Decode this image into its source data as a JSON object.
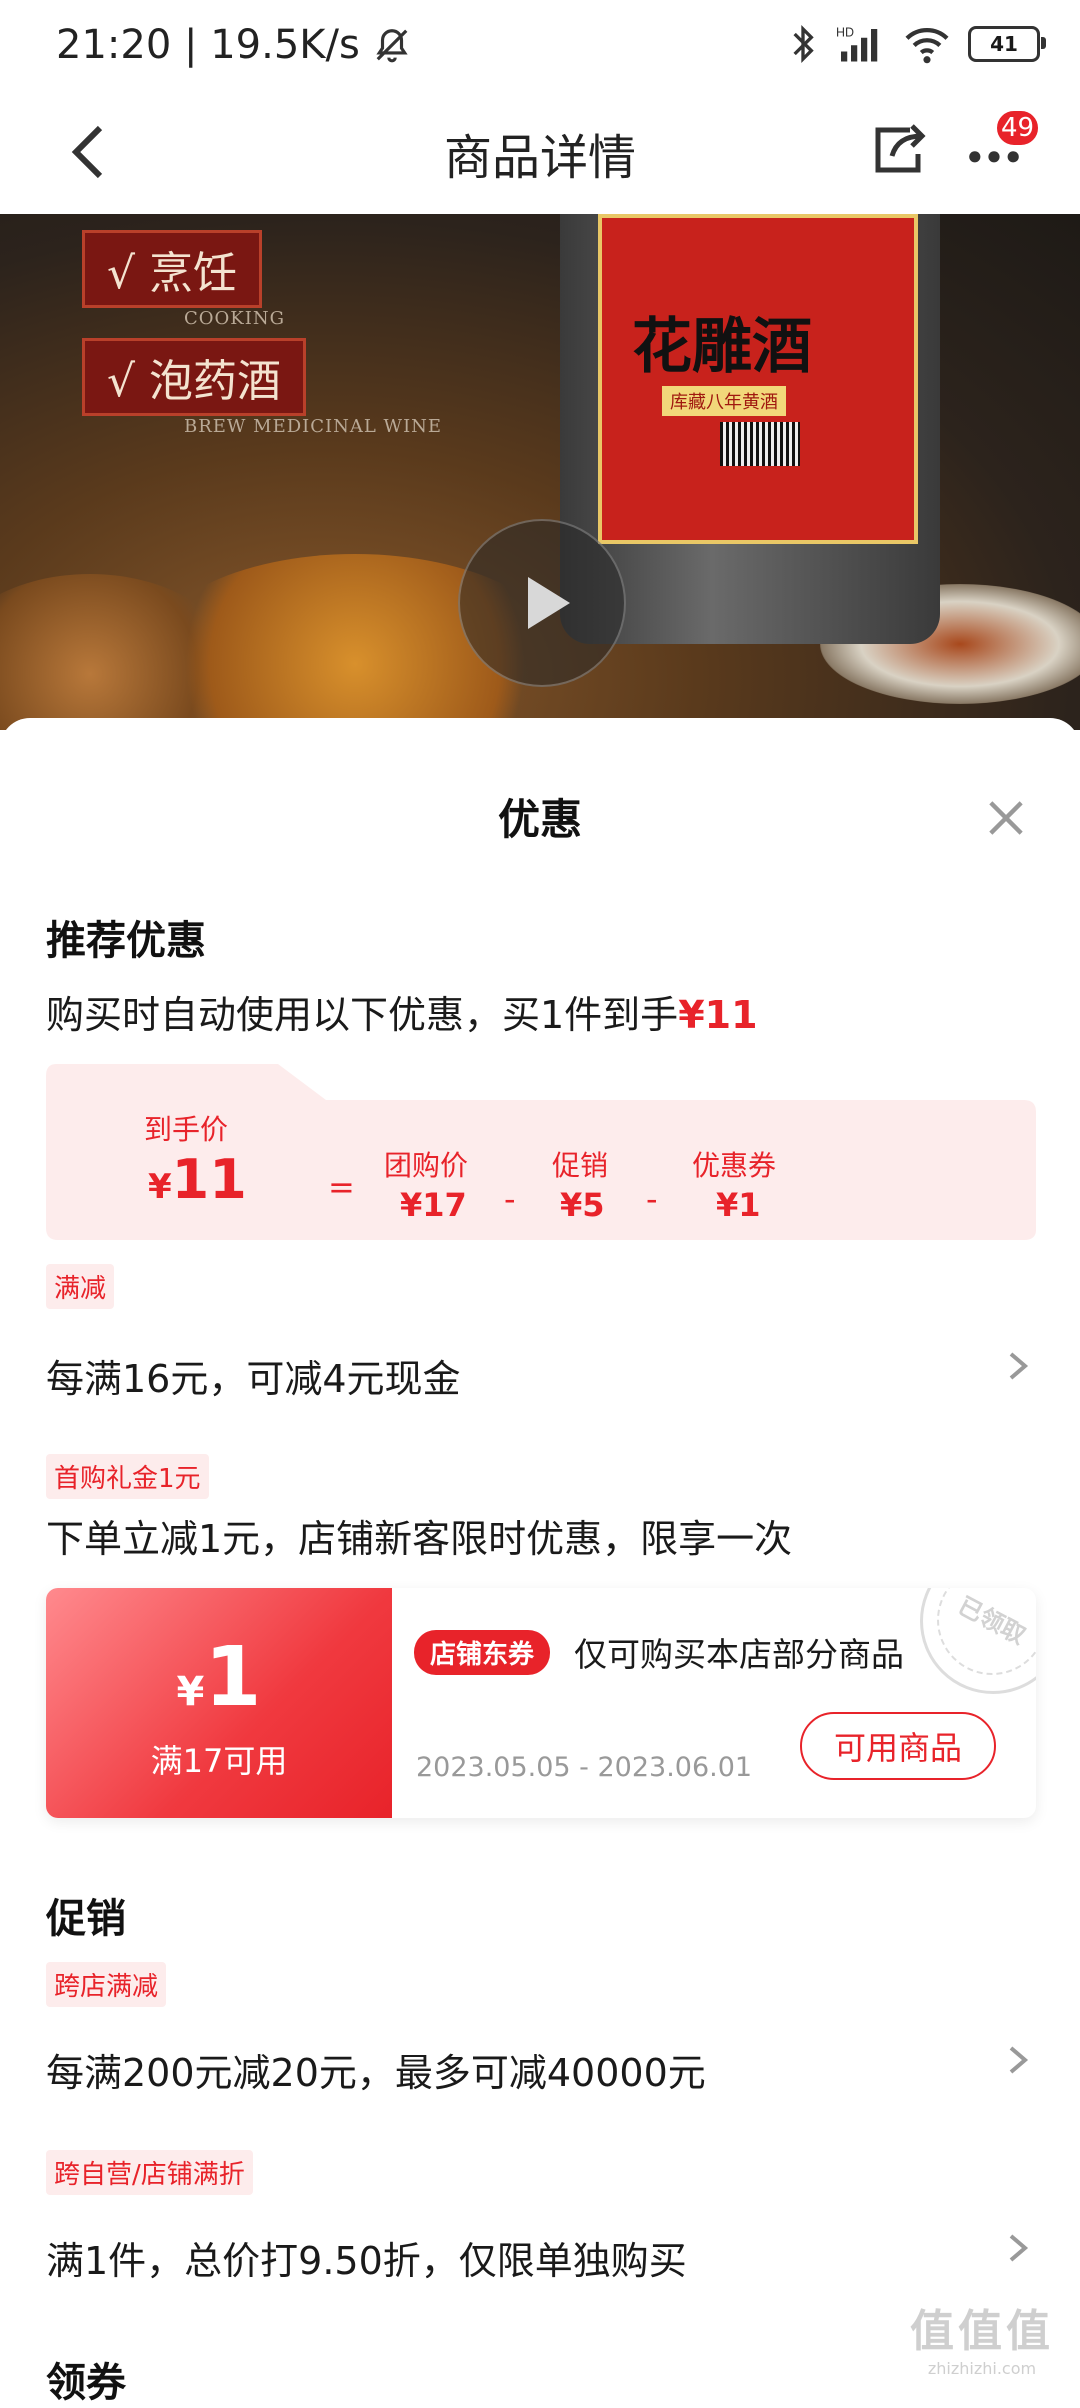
{
  "status_bar": {
    "time": "21:20",
    "speed": "19.5K/s",
    "battery": "41"
  },
  "nav": {
    "title": "商品详情",
    "more_badge": "49"
  },
  "media": {
    "tag1": "√ 烹饪",
    "tag1_sub": "COOKING",
    "tag2": "√ 泡药酒",
    "tag2_sub": "BREW MEDICINAL WINE",
    "product_label": "花雕酒",
    "product_label_sub": "库藏八年黄酒"
  },
  "sheet": {
    "title": "优惠",
    "recommend": {
      "title": "推荐优惠",
      "summary_prefix": "购买时自动使用以下优惠，买1件到手",
      "summary_price": "¥11",
      "breakdown": {
        "final_label": "到手价",
        "final_yen": "¥",
        "final_value": "11",
        "eq": "=",
        "group_label": "团购价",
        "group_value": "¥17",
        "minus1": "-",
        "promo_label": "促销",
        "promo_value": "¥5",
        "minus2": "-",
        "coupon_label": "优惠券",
        "coupon_value": "¥1"
      }
    },
    "manjian": {
      "tag": "满减",
      "text": "每满16元，可减4元现金"
    },
    "first_buy": {
      "tag": "首购礼金1元",
      "text": "下单立减1元，店铺新客限时优惠，限享一次"
    },
    "coupon": {
      "yen": "¥",
      "amount": "1",
      "condition": "满17可用",
      "tag": "店铺东券",
      "desc": "仅可购买本店部分商品",
      "date": "2023.05.05 - 2023.06.01",
      "button": "可用商品",
      "stamp": "已领取"
    },
    "promotion": {
      "title": "促销",
      "items": [
        {
          "tag": "跨店满减",
          "text": "每满200元减20元，最多可减40000元"
        },
        {
          "tag": "跨自营/店铺满折",
          "text": "满1件，总价打9.50折，仅限单独购买"
        }
      ]
    },
    "get_coupon": {
      "title": "领券"
    }
  },
  "watermark": {
    "big": "值值值",
    "small": "zhizhizhi.com"
  },
  "colors": {
    "accent": "#e8232a",
    "pill_bg": "#fdecec"
  }
}
